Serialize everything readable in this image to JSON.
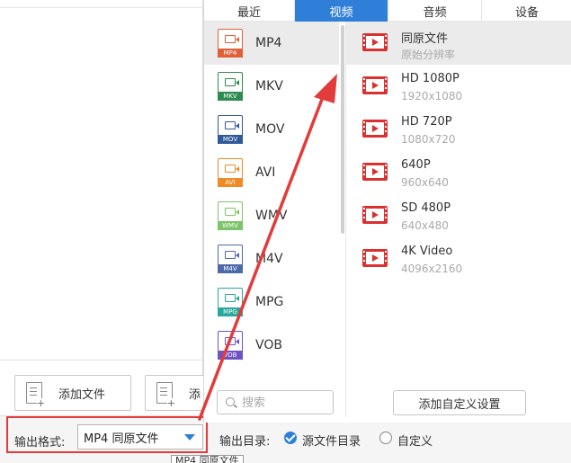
{
  "left_panel": {
    "add_file_label": "添加文件",
    "add_folder_label": "添"
  },
  "bottom_bar": {
    "format_label": "输出格式:",
    "format_value": "MP4 同原文件",
    "output_dir_label": "输出目录:",
    "radio_source_label": "源文件目录",
    "radio_custom_label": "自定义",
    "tooltip_text": "MP4 同原文件"
  },
  "popup": {
    "tabs": [
      "最近",
      "视频",
      "音频",
      "设备"
    ],
    "active_tab": "视频",
    "formats": [
      {
        "name": "MP4",
        "tag": "MP4",
        "color": "#e0603a"
      },
      {
        "name": "MKV",
        "tag": "MKV",
        "color": "#2e8b4f"
      },
      {
        "name": "MOV",
        "tag": "MOV",
        "color": "#2f5a9a"
      },
      {
        "name": "AVI",
        "tag": "AVI",
        "color": "#f08a24"
      },
      {
        "name": "WMV",
        "tag": "WMV",
        "color": "#7cc46a"
      },
      {
        "name": "M4V",
        "tag": "M4V",
        "color": "#4e6aa8"
      },
      {
        "name": "MPG",
        "tag": "MPG",
        "color": "#27a89a"
      },
      {
        "name": "VOB",
        "tag": "VOB",
        "color": "#6e52c2"
      }
    ],
    "selected_format": "MP4",
    "presets": [
      {
        "name": "同原文件",
        "res": "原始分辨率"
      },
      {
        "name": "HD 1080P",
        "res": "1920x1080"
      },
      {
        "name": "HD 720P",
        "res": "1080x720"
      },
      {
        "name": "640P",
        "res": "960x640"
      },
      {
        "name": "SD 480P",
        "res": "640x480"
      },
      {
        "name": "4K Video",
        "res": "4096x2160"
      }
    ],
    "search_placeholder": "搜索",
    "add_custom_label": "添加自定义设置"
  },
  "colors": {
    "accent": "#2f7fd9",
    "annotation": "#e23b3b",
    "preset_icon": "#d93030"
  }
}
